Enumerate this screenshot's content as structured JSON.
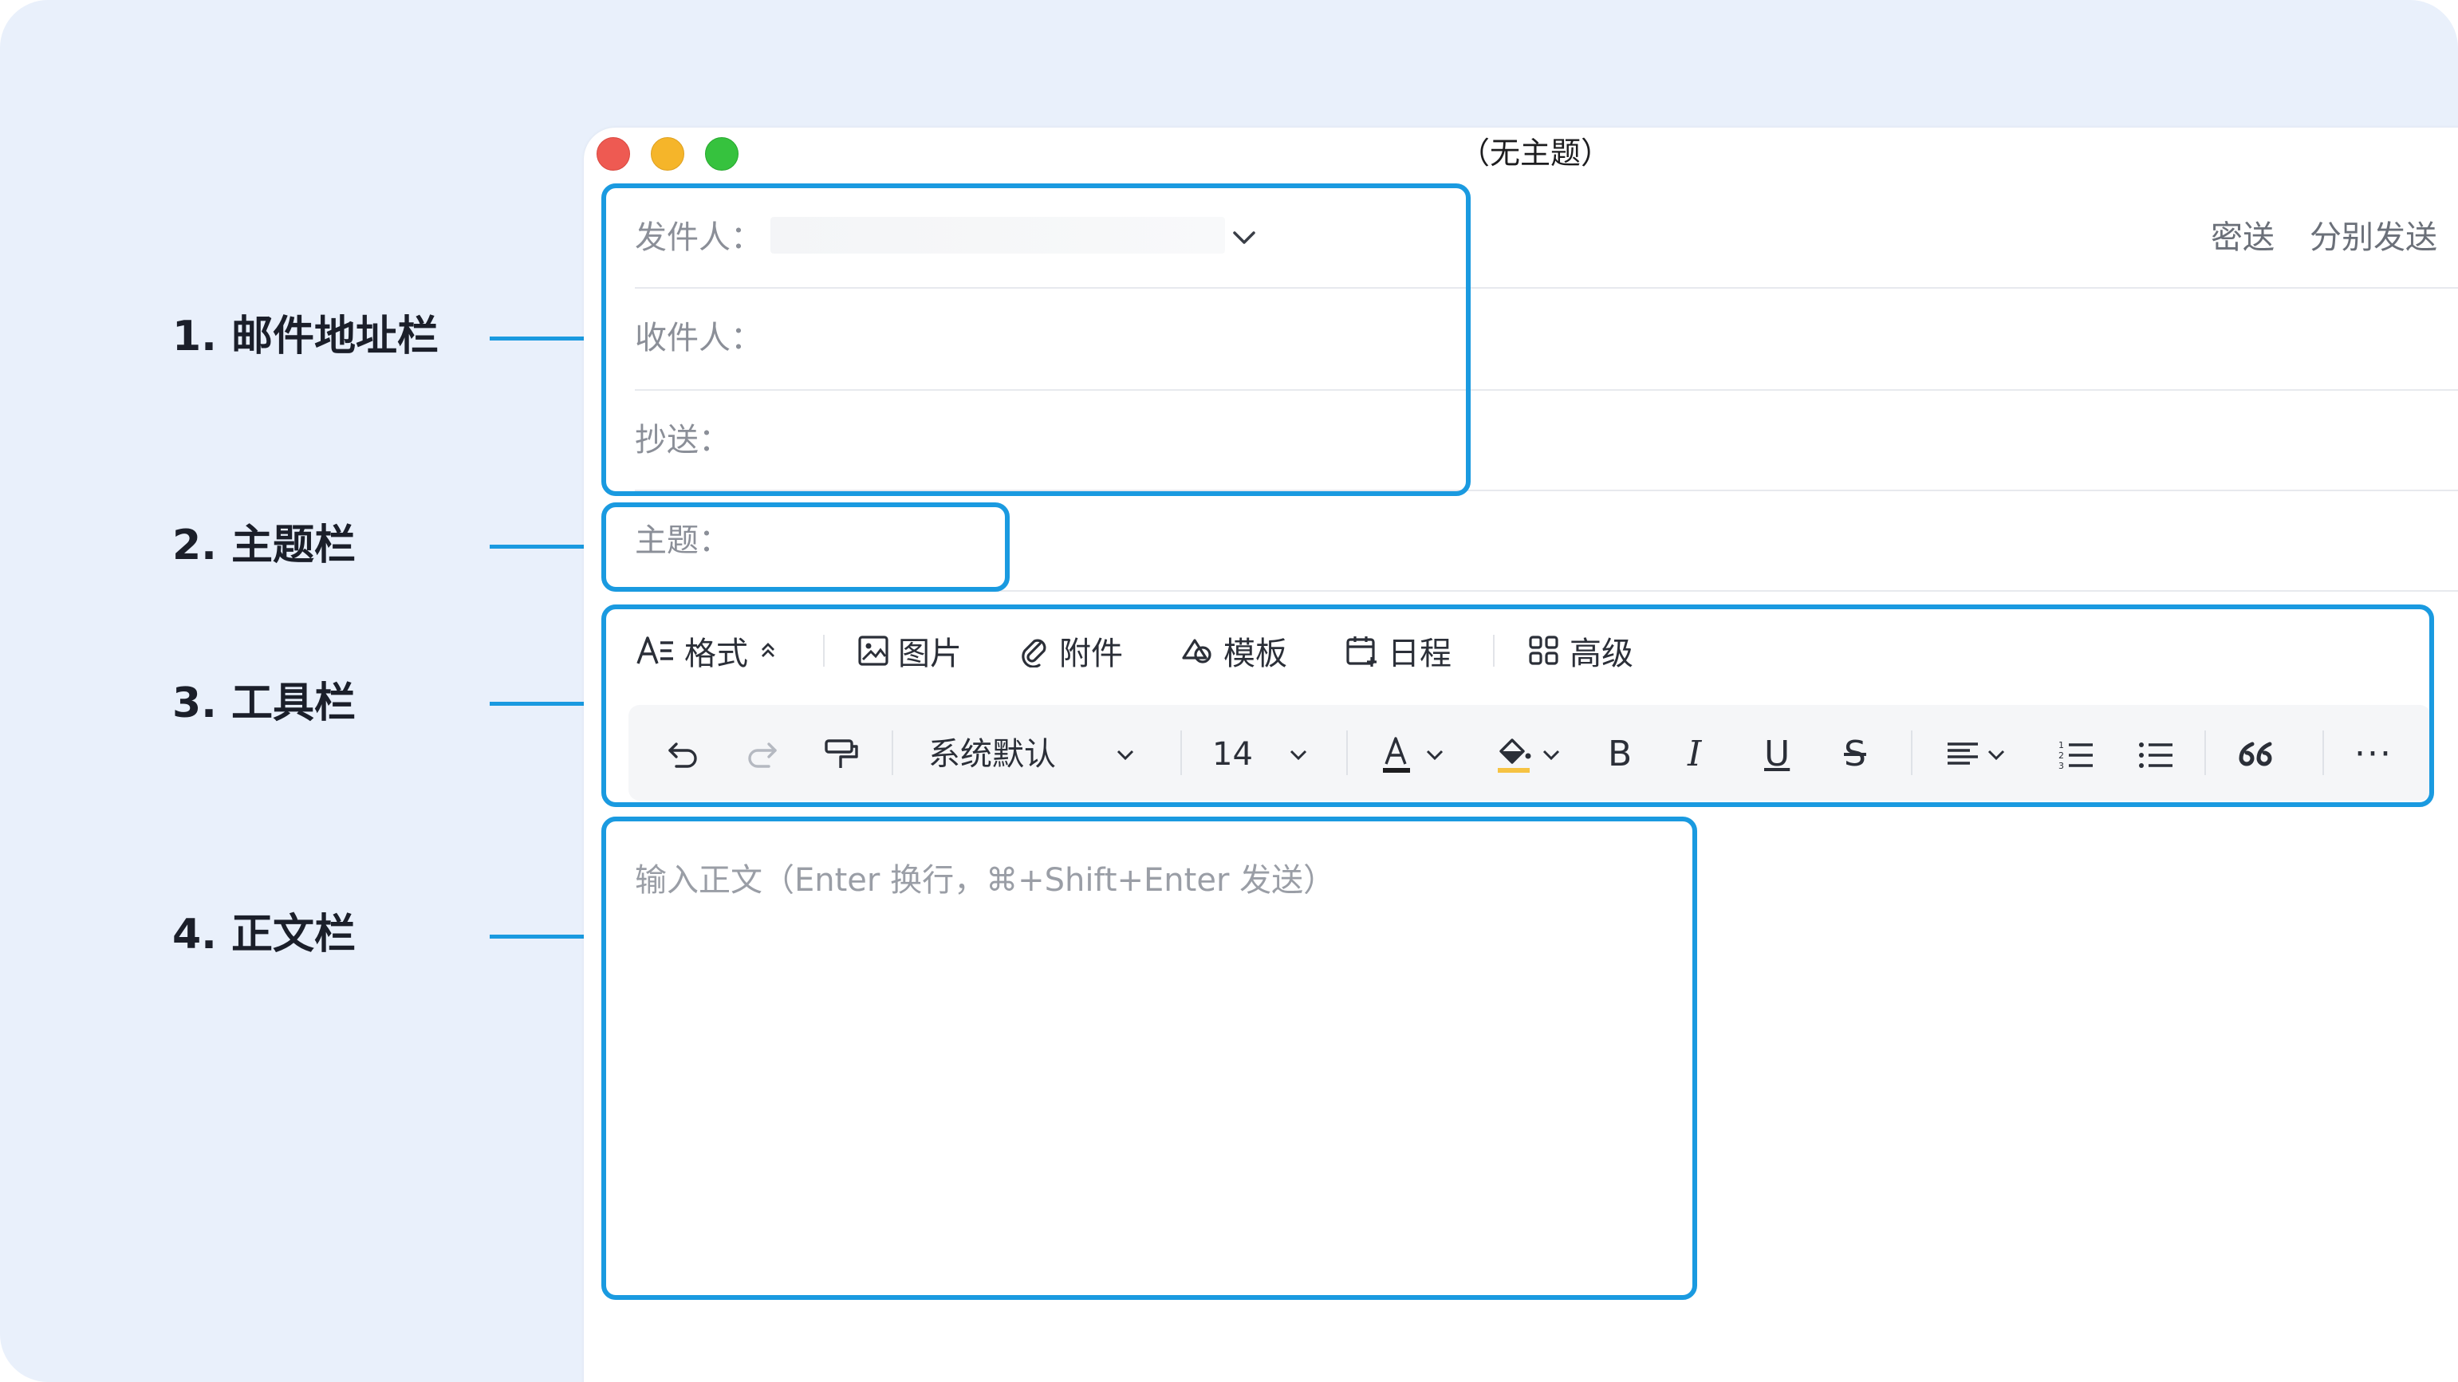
{
  "annotations": [
    {
      "label": "1. 邮件地址栏"
    },
    {
      "label": "2. 主题栏"
    },
    {
      "label": "3. 工具栏"
    },
    {
      "label": "4. 正文栏"
    }
  ],
  "window": {
    "title": "（无主题）"
  },
  "address": {
    "sender_label": "发件人：",
    "recipient_label": "收件人：",
    "cc_label": "抄送：",
    "bcc_label": "密送",
    "separate_send_label": "分别发送"
  },
  "subject": {
    "label": "主题："
  },
  "toolbar": {
    "format": "格式",
    "image": "图片",
    "attachment": "附件",
    "template": "模板",
    "schedule": "日程",
    "advanced": "高级"
  },
  "format_bar": {
    "font_family": "系统默认",
    "font_size": "14",
    "bold": "B",
    "italic": "I",
    "underline": "U",
    "strike": "S",
    "more": "···"
  },
  "body": {
    "placeholder": "输入正文（Enter 换行，⌘+Shift+Enter 发送）"
  },
  "colors": {
    "accent": "#1a9ae0",
    "background": "#e9f0fb",
    "text_color_underline": "#1d1d1f",
    "highlight_color": "#f6c343"
  }
}
